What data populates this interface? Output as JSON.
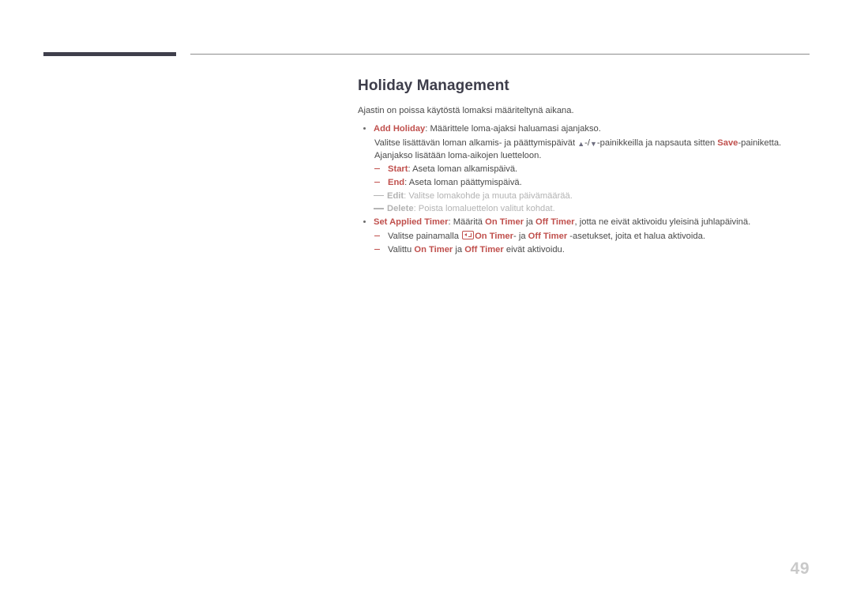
{
  "page": {
    "number": "49"
  },
  "header": {
    "title": "Holiday Management"
  },
  "body": {
    "intro": "Ajastin on poissa käytöstä lomaksi määriteltynä aikana.",
    "items": [
      {
        "term": "Add Holiday",
        "desc": ": Määrittele loma-ajaksi haluamasi ajanjakso.",
        "lines": [
          {
            "pre": "Valitse lisättävän loman alkamis- ja päättymispäivät ",
            "key_up": "▲",
            "mid1": "-/",
            "key_down": "▼",
            "mid2": "-painikkeilla ja napsauta sitten ",
            "accent": "Save",
            "post": "-painiketta."
          },
          {
            "text": "Ajanjakso lisätään loma-aikojen luetteloon."
          }
        ],
        "subitems": [
          {
            "term": "Start",
            "desc": ": Aseta loman alkamispäivä.",
            "style": "accent"
          },
          {
            "term": "End",
            "desc": ": Aseta loman päättymispäivä.",
            "style": "accent"
          },
          {
            "term": "Edit",
            "desc": ": Valitse lomakohde ja muuta päivämäärää.",
            "style": "muted"
          },
          {
            "term": "Delete",
            "desc": ": Poista lomaluettelon valitut kohdat.",
            "style": "muted"
          }
        ]
      },
      {
        "term": "Set Applied Timer",
        "desc_parts": {
          "a": ": Määritä ",
          "b": "On Timer",
          "c": " ja ",
          "d": "Off Timer",
          "e": ", jotta ne eivät aktivoidu yleisinä juhlapäivinä."
        },
        "subitems_plain": [
          {
            "a": "Valitse painamalla ",
            "icon": "enter-key-icon",
            "b": "On Timer",
            "c": "- ja ",
            "d": "Off Timer",
            "e": " -asetukset, joita et halua aktivoida."
          },
          {
            "a": "Valittu ",
            "b": "On Timer",
            "c": " ja ",
            "d": "Off Timer",
            "e": " eivät aktivoidu."
          }
        ]
      }
    ]
  },
  "colors": {
    "accent": "#c0504d",
    "title": "#3d3d4a",
    "muted": "#b3b3b3",
    "rule": "#3f3f4c"
  }
}
